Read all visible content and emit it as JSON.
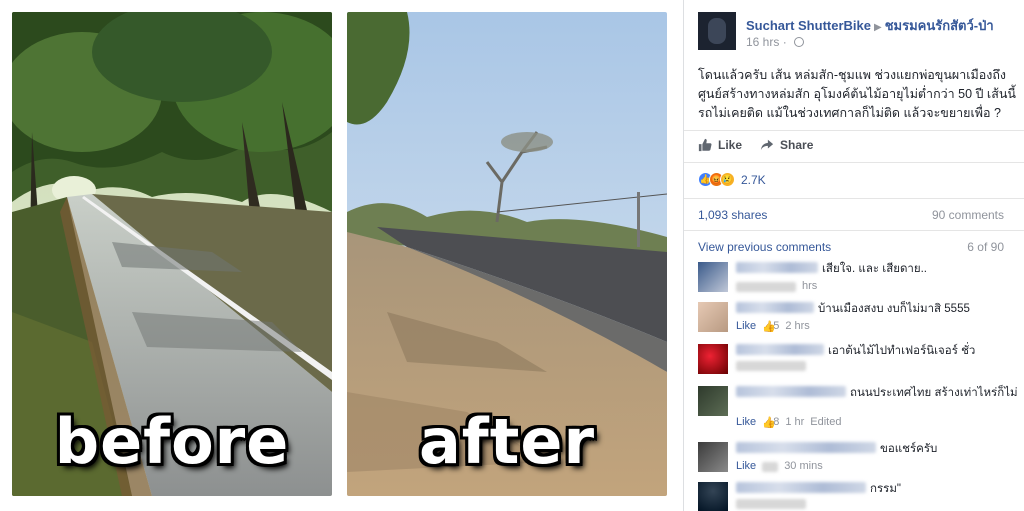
{
  "photo": {
    "left_label": "before",
    "right_label": "after"
  },
  "post": {
    "author": "Suchart ShutterBike",
    "group": "ชมรมคนรักสัตว์-ป่า",
    "time": "16 hrs",
    "text": "โดนแล้วครับ เส้น หล่มสัก-ชุมแพ ช่วงแยกพ่อขุนผาเมืองถึงศูนย์สร้างทางหล่มสัก อุโมงค์ต้นไม้อายุไม่ต่ำกว่า 50 ปี เส้นนี้รถไม่เคยติด แม้ในช่วงเทศกาลก็ไม่ติด แล้วจะขยายเพื่อ ?",
    "like_label": "Like",
    "share_label": "Share",
    "reaction_count": "2.7K",
    "shares": "1,093 shares",
    "comments": "90 comments",
    "view_previous": "View previous comments",
    "pages": "6 of 90"
  },
  "comments": [
    {
      "text": "เสียใจ. และ เสียดาย..",
      "meta_time": "hrs",
      "like": "",
      "count": ""
    },
    {
      "text": "บ้านเมืองสงบ งบก็ไม่มาสิ 5555",
      "meta_like": "Like",
      "count": "5",
      "meta_time": "2 hrs"
    },
    {
      "text": "เอาต้นไม้ไปทำเฟอร์นิเจอร์ ชั่ว"
    },
    {
      "text": "ถนนประเทศไทย สร้างเท่าไหร่ก็ไม่",
      "meta_like": "Like",
      "count": "8",
      "meta_time": "1 hr",
      "edited": "Edited"
    },
    {
      "text": "ขอแชร์ครับ",
      "meta_like": "Like",
      "meta_time": "30 mins"
    },
    {
      "text": "กรรม\""
    }
  ],
  "colors": {
    "link": "#365899",
    "muted": "#90949c",
    "like_reaction": "#4080ff"
  }
}
